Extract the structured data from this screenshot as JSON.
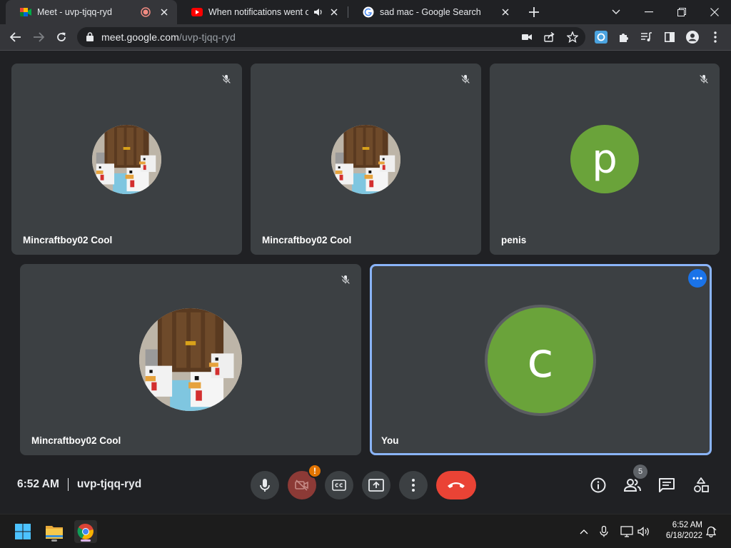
{
  "browser": {
    "tabs": [
      {
        "title": "Meet - uvp-tjqq-ryd",
        "active": true
      },
      {
        "title": "When notifications went off i",
        "active": false
      },
      {
        "title": "sad mac - Google Search",
        "active": false
      }
    ],
    "url_host": "meet.google.com",
    "url_path": "/uvp-tjqq-ryd"
  },
  "meeting": {
    "tiles": [
      {
        "name": "Mincraftboy02 Cool"
      },
      {
        "name": "Mincraftboy02 Cool"
      },
      {
        "name": "penis",
        "initial": "p"
      },
      {
        "name": "Mincraftboy02 Cool"
      },
      {
        "name": "You",
        "initial": "c"
      }
    ],
    "time": "6:52 AM",
    "code": "uvp-tjqq-ryd",
    "camera_warning": "!",
    "participant_count": "5"
  },
  "taskbar": {
    "time": "6:52 AM",
    "date": "6/18/2022"
  },
  "colors": {
    "accent": "#8ab4f8",
    "avatar_green": "#6aa33a",
    "hangup_red": "#ea4335",
    "tile_bg": "#3c4043"
  }
}
